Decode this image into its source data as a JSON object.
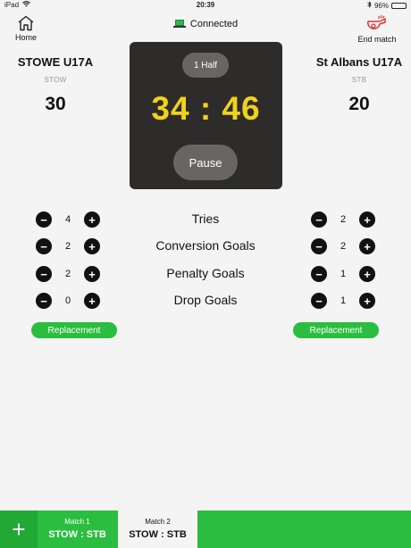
{
  "status_bar": {
    "device": "iPad",
    "time": "20:39",
    "battery": "96%",
    "battery_level": 0.96
  },
  "header": {
    "home_label": "Home",
    "connection": "Connected",
    "end_match_label": "End match"
  },
  "teams": {
    "home": {
      "name": "STOWE U17A",
      "abbr": "STOW",
      "score": "30"
    },
    "away": {
      "name": "St Albans U17A",
      "abbr": "STB",
      "score": "20"
    }
  },
  "clock": {
    "half": "1 Half",
    "time": "34 : 46",
    "pause_label": "Pause"
  },
  "stats": [
    {
      "label": "Tries",
      "home": "4",
      "away": "2"
    },
    {
      "label": "Conversion Goals",
      "home": "2",
      "away": "2"
    },
    {
      "label": "Penalty Goals",
      "home": "2",
      "away": "1"
    },
    {
      "label": "Drop Goals",
      "home": "0",
      "away": "1"
    }
  ],
  "controls": {
    "minus": "−",
    "plus": "+"
  },
  "replacement_label": "Replacement",
  "tabs": {
    "add": "+",
    "items": [
      {
        "name": "Match 1",
        "teams": "STOW : STB"
      },
      {
        "name": "Match 2",
        "teams": "STOW : STB"
      }
    ]
  },
  "colors": {
    "accent_green": "#2bbd3f",
    "clock_yellow": "#f0d21b",
    "panel": "#2e2b2b",
    "end_match_red": "#e0332b"
  }
}
